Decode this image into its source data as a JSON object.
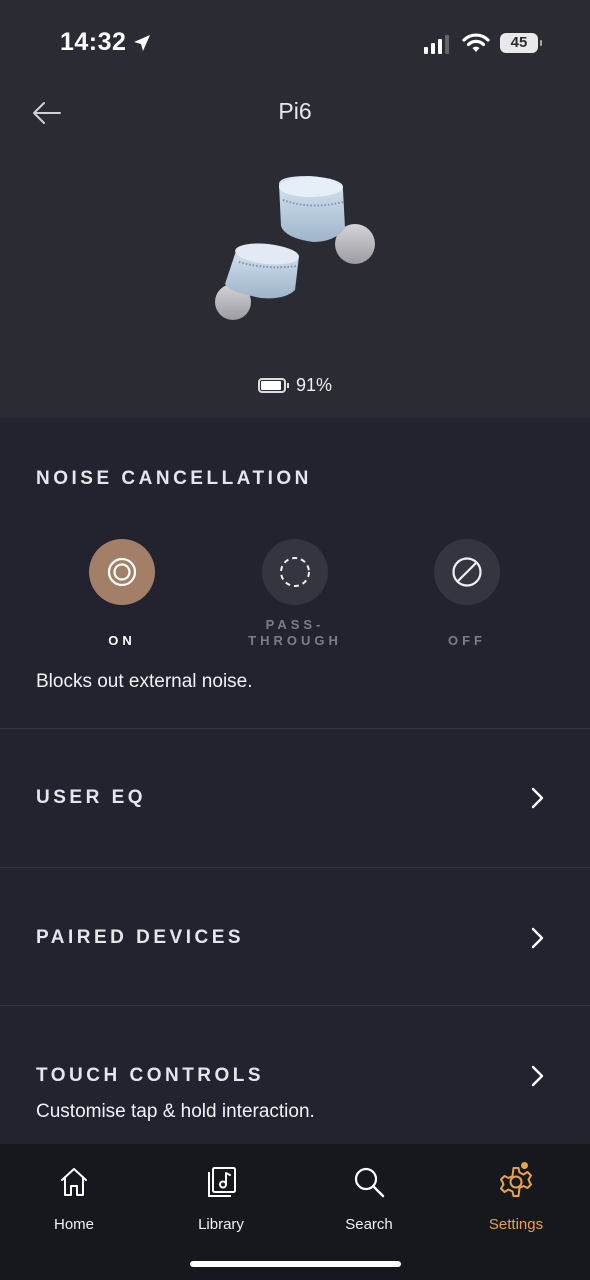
{
  "status": {
    "time": "14:32",
    "battery": "45"
  },
  "header": {
    "title": "Pi6"
  },
  "device": {
    "battery_text": "91%",
    "battery_level": 0.91
  },
  "noise_cancellation": {
    "heading": "NOISE CANCELLATION",
    "options": [
      {
        "label": "ON",
        "selected": true
      },
      {
        "label": "PASS-\nTHROUGH",
        "selected": false
      },
      {
        "label": "OFF",
        "selected": false
      }
    ],
    "description": "Blocks out external noise."
  },
  "menu": [
    {
      "label": "USER EQ"
    },
    {
      "label": "PAIRED DEVICES"
    },
    {
      "label": "TOUCH CONTROLS",
      "subtitle": "Customise tap & hold interaction."
    }
  ],
  "tabs": [
    {
      "label": "Home",
      "icon": "home-icon"
    },
    {
      "label": "Library",
      "icon": "library-icon"
    },
    {
      "label": "Search",
      "icon": "search-icon"
    },
    {
      "label": "Settings",
      "icon": "gear-icon",
      "active": true
    }
  ],
  "colors": {
    "accent": "#e8a24a",
    "selected": "#a37f67",
    "background": "#22232f",
    "header": "#2b2b34"
  }
}
